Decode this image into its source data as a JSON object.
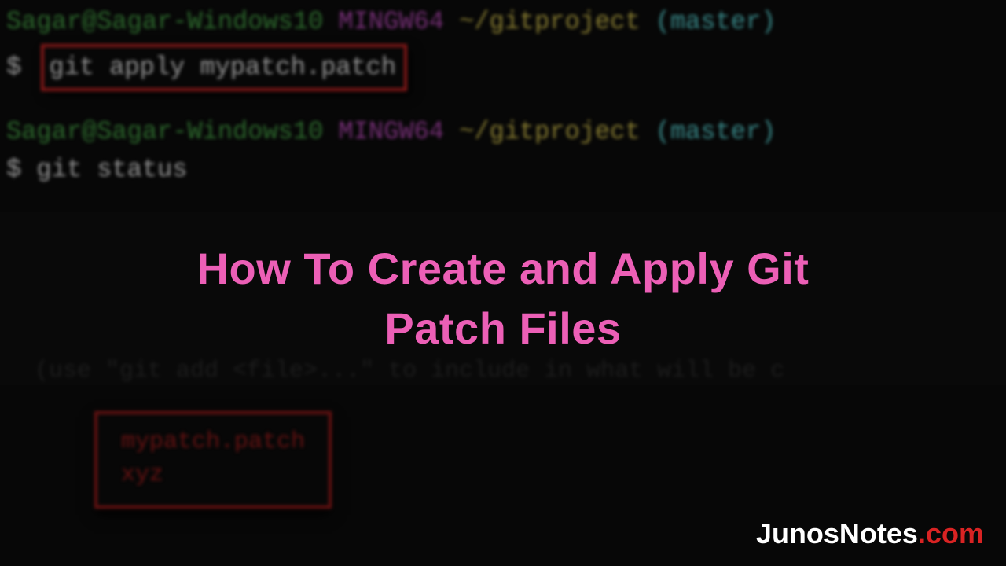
{
  "prompt": {
    "user": "Sagar@Sagar-Windows10",
    "mingw": "MINGW64",
    "path": "~/gitproject",
    "branch": "(master)",
    "dollar": "$"
  },
  "commands": {
    "apply": "git apply mypatch.patch",
    "status": "git status"
  },
  "hint": "(use \"git add <file>...\" to include in what will be c",
  "untracked": {
    "file1": "mypatch.patch",
    "file2": "xyz"
  },
  "title": {
    "line1": "How To Create and Apply Git",
    "line2": "Patch Files"
  },
  "watermark": {
    "part1": "JunosNotes",
    "part2": ".com"
  }
}
